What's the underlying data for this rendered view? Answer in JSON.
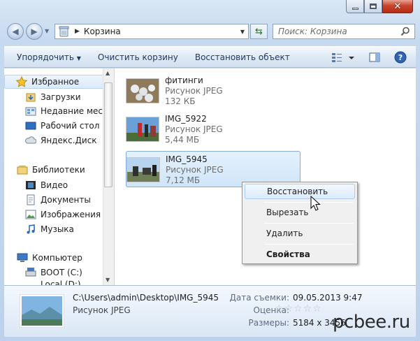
{
  "address": {
    "path": "Корзина"
  },
  "search": {
    "placeholder": "Поиск: Корзина"
  },
  "toolbar": {
    "organize": "Упорядочить",
    "empty_bin": "Очистить корзину",
    "restore_item": "Восстановить объект"
  },
  "nav": {
    "favorites": "Избранное",
    "downloads": "Загрузки",
    "recent": "Недавние места",
    "desktop": "Рабочий стол",
    "yandex": "Яндекс.Диск",
    "libraries": "Библиотеки",
    "video": "Видео",
    "documents": "Документы",
    "images": "Изображения",
    "music": "Музыка",
    "computer": "Компьютер",
    "boot": "BOOT (C:)",
    "partial": "Local (D:)"
  },
  "files": [
    {
      "name": "фитинги",
      "type": "Рисунок JPEG",
      "size": "132 КБ"
    },
    {
      "name": "IMG_5922",
      "type": "Рисунок JPEG",
      "size": "5,44 МБ"
    },
    {
      "name": "IMG_5945",
      "type": "Рисунок JPEG",
      "size": "7,12 МБ"
    }
  ],
  "context_menu": {
    "restore": "Восстановить",
    "cut": "Вырезать",
    "delete": "Удалить",
    "properties": "Свойства"
  },
  "details": {
    "path": "C:\\Users\\admin\\Desktop\\IMG_5945",
    "type": "Рисунок JPEG",
    "date_label": "Дата съемки:",
    "date_value": "09.05.2013 9:47",
    "rating_label": "Оценка:",
    "rating_stars": "☆☆☆☆☆",
    "size_label": "Размеры:",
    "size_value": "5184 x 3456"
  },
  "watermark": "pcbee.ru",
  "icons": {
    "back": "back-arrow-icon",
    "forward": "forward-arrow-icon",
    "recycle": "recycle-bin-icon",
    "search": "search-icon",
    "help": "help-icon",
    "cursor": "mouse-cursor-icon"
  }
}
